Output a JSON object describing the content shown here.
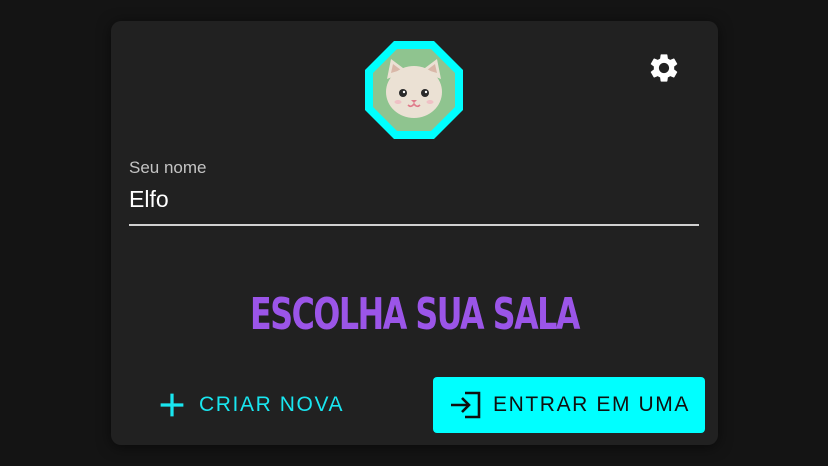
{
  "profile": {
    "name_label": "Seu nome",
    "name_value": "Elfo",
    "avatar_icon": "cat-face-icon",
    "avatar_border_color": "#00ffff",
    "avatar_bg_color": "#8fc48f"
  },
  "settings": {
    "icon": "gear-icon"
  },
  "room": {
    "heading": "ESCOLHA SUA SALA"
  },
  "actions": {
    "create_label": "CRIAR NOVA",
    "create_icon": "plus-icon",
    "join_label": "ENTRAR EM UMA",
    "join_icon": "login-icon"
  },
  "colors": {
    "accent_cyan": "#00ffff",
    "heading_purple": "#9b55e8",
    "card_bg": "#212121",
    "page_bg": "#141414"
  }
}
